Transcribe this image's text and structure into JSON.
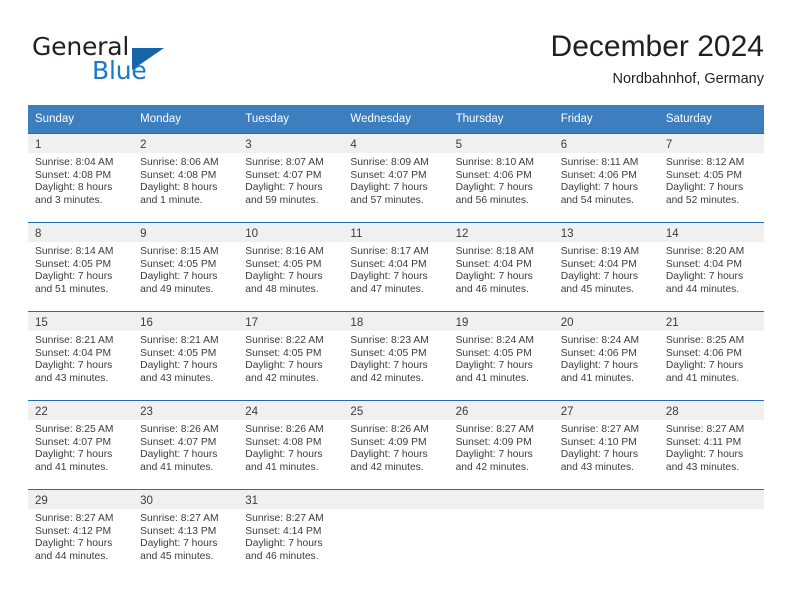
{
  "brand": {
    "name_top": "General",
    "name_bottom": "Blue",
    "triangle_icon": "triangle-icon",
    "accent_color": "#1a7ac4",
    "triangle_color": "#1565a8"
  },
  "header": {
    "title": "December 2024",
    "subtitle": "Nordbahnhof, Germany"
  },
  "theme": {
    "header_row_bg": "#3d7ebf",
    "daynum_band_bg": "#f0f0f0",
    "row_divider": "#1f6cb0",
    "text": "#3c3c3c"
  },
  "weekday_headers": [
    "Sunday",
    "Monday",
    "Tuesday",
    "Wednesday",
    "Thursday",
    "Friday",
    "Saturday"
  ],
  "weeks": [
    [
      {
        "day": "1",
        "sunrise": "Sunrise: 8:04 AM",
        "sunset": "Sunset: 4:08 PM",
        "daylight_line1": "Daylight: 8 hours",
        "daylight_line2": "and 3 minutes."
      },
      {
        "day": "2",
        "sunrise": "Sunrise: 8:06 AM",
        "sunset": "Sunset: 4:08 PM",
        "daylight_line1": "Daylight: 8 hours",
        "daylight_line2": "and 1 minute."
      },
      {
        "day": "3",
        "sunrise": "Sunrise: 8:07 AM",
        "sunset": "Sunset: 4:07 PM",
        "daylight_line1": "Daylight: 7 hours",
        "daylight_line2": "and 59 minutes."
      },
      {
        "day": "4",
        "sunrise": "Sunrise: 8:09 AM",
        "sunset": "Sunset: 4:07 PM",
        "daylight_line1": "Daylight: 7 hours",
        "daylight_line2": "and 57 minutes."
      },
      {
        "day": "5",
        "sunrise": "Sunrise: 8:10 AM",
        "sunset": "Sunset: 4:06 PM",
        "daylight_line1": "Daylight: 7 hours",
        "daylight_line2": "and 56 minutes."
      },
      {
        "day": "6",
        "sunrise": "Sunrise: 8:11 AM",
        "sunset": "Sunset: 4:06 PM",
        "daylight_line1": "Daylight: 7 hours",
        "daylight_line2": "and 54 minutes."
      },
      {
        "day": "7",
        "sunrise": "Sunrise: 8:12 AM",
        "sunset": "Sunset: 4:05 PM",
        "daylight_line1": "Daylight: 7 hours",
        "daylight_line2": "and 52 minutes."
      }
    ],
    [
      {
        "day": "8",
        "sunrise": "Sunrise: 8:14 AM",
        "sunset": "Sunset: 4:05 PM",
        "daylight_line1": "Daylight: 7 hours",
        "daylight_line2": "and 51 minutes."
      },
      {
        "day": "9",
        "sunrise": "Sunrise: 8:15 AM",
        "sunset": "Sunset: 4:05 PM",
        "daylight_line1": "Daylight: 7 hours",
        "daylight_line2": "and 49 minutes."
      },
      {
        "day": "10",
        "sunrise": "Sunrise: 8:16 AM",
        "sunset": "Sunset: 4:05 PM",
        "daylight_line1": "Daylight: 7 hours",
        "daylight_line2": "and 48 minutes."
      },
      {
        "day": "11",
        "sunrise": "Sunrise: 8:17 AM",
        "sunset": "Sunset: 4:04 PM",
        "daylight_line1": "Daylight: 7 hours",
        "daylight_line2": "and 47 minutes."
      },
      {
        "day": "12",
        "sunrise": "Sunrise: 8:18 AM",
        "sunset": "Sunset: 4:04 PM",
        "daylight_line1": "Daylight: 7 hours",
        "daylight_line2": "and 46 minutes."
      },
      {
        "day": "13",
        "sunrise": "Sunrise: 8:19 AM",
        "sunset": "Sunset: 4:04 PM",
        "daylight_line1": "Daylight: 7 hours",
        "daylight_line2": "and 45 minutes."
      },
      {
        "day": "14",
        "sunrise": "Sunrise: 8:20 AM",
        "sunset": "Sunset: 4:04 PM",
        "daylight_line1": "Daylight: 7 hours",
        "daylight_line2": "and 44 minutes."
      }
    ],
    [
      {
        "day": "15",
        "sunrise": "Sunrise: 8:21 AM",
        "sunset": "Sunset: 4:04 PM",
        "daylight_line1": "Daylight: 7 hours",
        "daylight_line2": "and 43 minutes."
      },
      {
        "day": "16",
        "sunrise": "Sunrise: 8:21 AM",
        "sunset": "Sunset: 4:05 PM",
        "daylight_line1": "Daylight: 7 hours",
        "daylight_line2": "and 43 minutes."
      },
      {
        "day": "17",
        "sunrise": "Sunrise: 8:22 AM",
        "sunset": "Sunset: 4:05 PM",
        "daylight_line1": "Daylight: 7 hours",
        "daylight_line2": "and 42 minutes."
      },
      {
        "day": "18",
        "sunrise": "Sunrise: 8:23 AM",
        "sunset": "Sunset: 4:05 PM",
        "daylight_line1": "Daylight: 7 hours",
        "daylight_line2": "and 42 minutes."
      },
      {
        "day": "19",
        "sunrise": "Sunrise: 8:24 AM",
        "sunset": "Sunset: 4:05 PM",
        "daylight_line1": "Daylight: 7 hours",
        "daylight_line2": "and 41 minutes."
      },
      {
        "day": "20",
        "sunrise": "Sunrise: 8:24 AM",
        "sunset": "Sunset: 4:06 PM",
        "daylight_line1": "Daylight: 7 hours",
        "daylight_line2": "and 41 minutes."
      },
      {
        "day": "21",
        "sunrise": "Sunrise: 8:25 AM",
        "sunset": "Sunset: 4:06 PM",
        "daylight_line1": "Daylight: 7 hours",
        "daylight_line2": "and 41 minutes."
      }
    ],
    [
      {
        "day": "22",
        "sunrise": "Sunrise: 8:25 AM",
        "sunset": "Sunset: 4:07 PM",
        "daylight_line1": "Daylight: 7 hours",
        "daylight_line2": "and 41 minutes."
      },
      {
        "day": "23",
        "sunrise": "Sunrise: 8:26 AM",
        "sunset": "Sunset: 4:07 PM",
        "daylight_line1": "Daylight: 7 hours",
        "daylight_line2": "and 41 minutes."
      },
      {
        "day": "24",
        "sunrise": "Sunrise: 8:26 AM",
        "sunset": "Sunset: 4:08 PM",
        "daylight_line1": "Daylight: 7 hours",
        "daylight_line2": "and 41 minutes."
      },
      {
        "day": "25",
        "sunrise": "Sunrise: 8:26 AM",
        "sunset": "Sunset: 4:09 PM",
        "daylight_line1": "Daylight: 7 hours",
        "daylight_line2": "and 42 minutes."
      },
      {
        "day": "26",
        "sunrise": "Sunrise: 8:27 AM",
        "sunset": "Sunset: 4:09 PM",
        "daylight_line1": "Daylight: 7 hours",
        "daylight_line2": "and 42 minutes."
      },
      {
        "day": "27",
        "sunrise": "Sunrise: 8:27 AM",
        "sunset": "Sunset: 4:10 PM",
        "daylight_line1": "Daylight: 7 hours",
        "daylight_line2": "and 43 minutes."
      },
      {
        "day": "28",
        "sunrise": "Sunrise: 8:27 AM",
        "sunset": "Sunset: 4:11 PM",
        "daylight_line1": "Daylight: 7 hours",
        "daylight_line2": "and 43 minutes."
      }
    ],
    [
      {
        "day": "29",
        "sunrise": "Sunrise: 8:27 AM",
        "sunset": "Sunset: 4:12 PM",
        "daylight_line1": "Daylight: 7 hours",
        "daylight_line2": "and 44 minutes."
      },
      {
        "day": "30",
        "sunrise": "Sunrise: 8:27 AM",
        "sunset": "Sunset: 4:13 PM",
        "daylight_line1": "Daylight: 7 hours",
        "daylight_line2": "and 45 minutes."
      },
      {
        "day": "31",
        "sunrise": "Sunrise: 8:27 AM",
        "sunset": "Sunset: 4:14 PM",
        "daylight_line1": "Daylight: 7 hours",
        "daylight_line2": "and 46 minutes."
      },
      {
        "day": "",
        "sunrise": "",
        "sunset": "",
        "daylight_line1": "",
        "daylight_line2": ""
      },
      {
        "day": "",
        "sunrise": "",
        "sunset": "",
        "daylight_line1": "",
        "daylight_line2": ""
      },
      {
        "day": "",
        "sunrise": "",
        "sunset": "",
        "daylight_line1": "",
        "daylight_line2": ""
      },
      {
        "day": "",
        "sunrise": "",
        "sunset": "",
        "daylight_line1": "",
        "daylight_line2": ""
      }
    ]
  ]
}
